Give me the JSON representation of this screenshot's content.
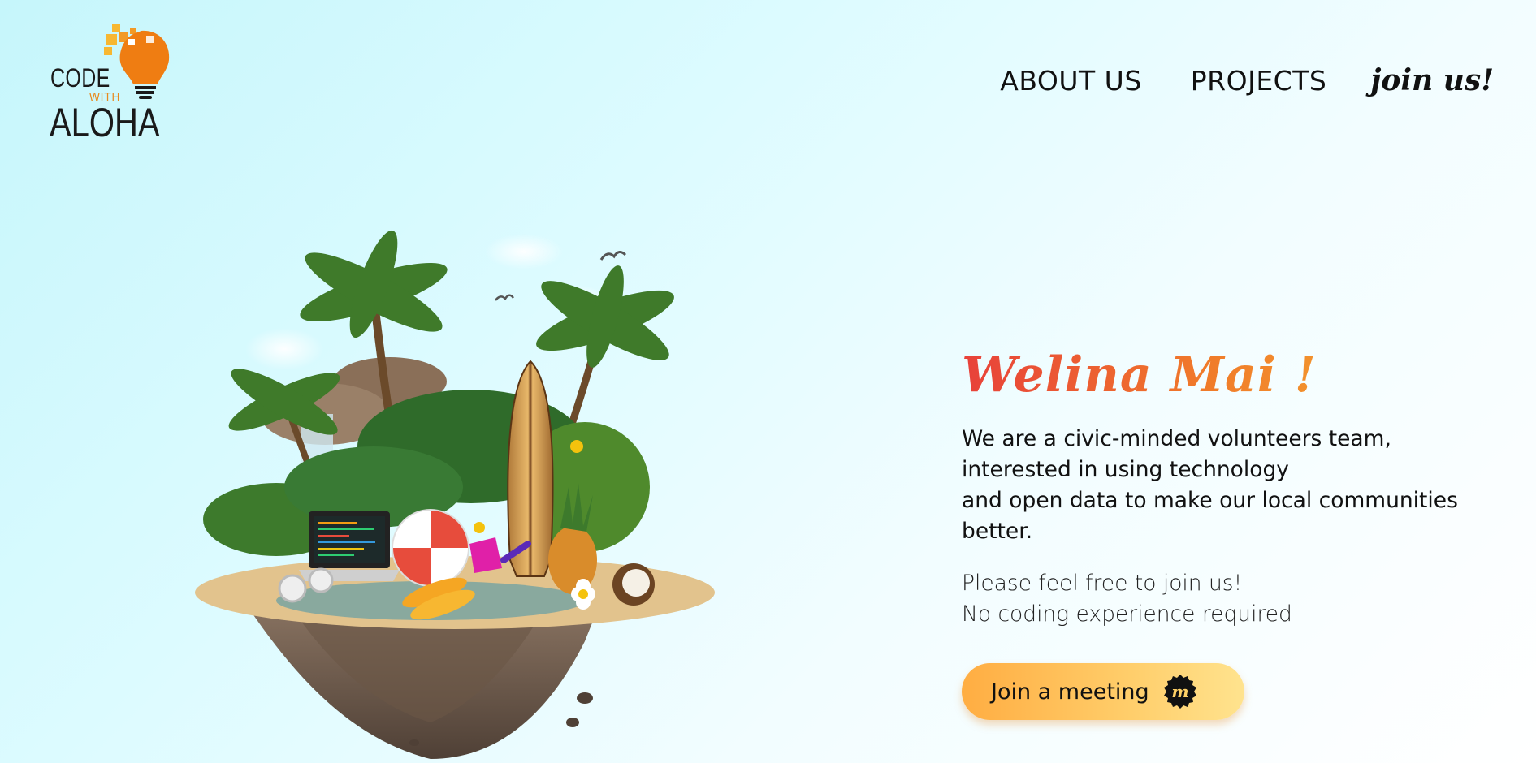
{
  "brand": {
    "logo_line1": "CODE",
    "logo_line2": "WITH",
    "logo_line3": "ALOHA",
    "colors": {
      "orange": "#e8891c",
      "yellow": "#f7b731",
      "dark": "#1a1a1a"
    }
  },
  "nav": {
    "about": "ABOUT US",
    "projects": "PROJECTS",
    "join": "join us!"
  },
  "hero": {
    "image_icon": "floating-island-illustration",
    "headline": "Welina Mai !",
    "intro_lines": [
      "We are a civic-minded volunteers team,",
      "interested in using technology",
      "and open data to make our local communities",
      "better."
    ],
    "invite_lines": [
      "Please feel free to join us!",
      "No coding experience required"
    ],
    "cta_label": "Join a meeting",
    "cta_icon": "meetup-icon"
  },
  "colors": {
    "bg_start": "#c6f6fb",
    "bg_end": "#ffffff",
    "headline_start": "#e8413a",
    "headline_end": "#f7b731",
    "button_start": "#ffad42",
    "button_end": "#ffe38e"
  }
}
